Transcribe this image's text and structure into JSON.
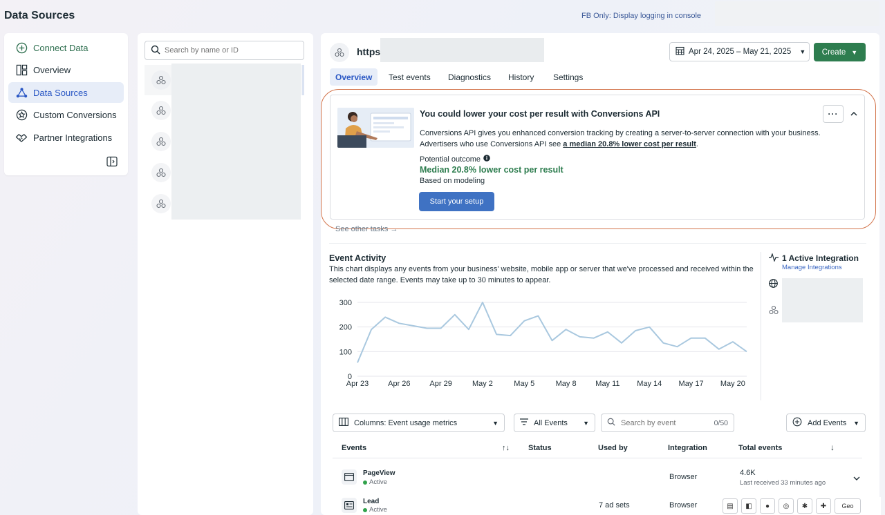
{
  "page_title": "Data Sources",
  "fb_only_link": "FB Only: Display logging in console",
  "leftnav": {
    "items": [
      {
        "label": "Connect Data",
        "icon": "plus-circle-icon"
      },
      {
        "label": "Overview",
        "icon": "layout-icon"
      },
      {
        "label": "Data Sources",
        "icon": "data-sources-icon"
      },
      {
        "label": "Custom Conversions",
        "icon": "star-badge-icon"
      },
      {
        "label": "Partner Integrations",
        "icon": "handshake-icon"
      }
    ]
  },
  "source_search": {
    "placeholder": "Search by name or ID"
  },
  "pixel": {
    "name": "https"
  },
  "date_range": "Apr 24, 2025 – May 21, 2025",
  "create_label": "Create",
  "tabs": [
    "Overview",
    "Test events",
    "Diagnostics",
    "History",
    "Settings"
  ],
  "promo": {
    "title": "You could lower your cost per result with Conversions API",
    "body_1": "Conversions API gives you enhanced conversion tracking by creating a server-to-server connection with your business. Advertisers who use Conversions API see",
    "body_bold": "a median 20.8% lower cost per result",
    "body_end": ".",
    "potential_label": "Potential outcome",
    "potential_value": "Median 20.8% lower cost per result",
    "based_on": "Based on modeling",
    "cta": "Start your setup",
    "more": "···"
  },
  "see_other_tasks": "See other tasks →",
  "event_activity": {
    "title": "Event Activity",
    "description": "This chart displays any events from your business' website, mobile app or server that we've processed and received within the selected date range. Events may take up to 30 minutes to appear."
  },
  "chart_data": {
    "type": "line",
    "x_ticks": [
      "Apr 23",
      "Apr 26",
      "Apr 29",
      "May 2",
      "May 5",
      "May 8",
      "May 11",
      "May 14",
      "May 17",
      "May 20"
    ],
    "y_ticks": [
      0,
      100,
      200,
      300
    ],
    "ylim": [
      0,
      300
    ],
    "x": [
      "Apr 23",
      "Apr 24",
      "Apr 25",
      "Apr 26",
      "Apr 27",
      "Apr 28",
      "Apr 29",
      "Apr 30",
      "May 1",
      "May 2",
      "May 3",
      "May 4",
      "May 5",
      "May 6",
      "May 7",
      "May 8",
      "May 9",
      "May 10",
      "May 11",
      "May 12",
      "May 13",
      "May 14",
      "May 15",
      "May 16",
      "May 17",
      "May 18",
      "May 19",
      "May 20",
      "May 21"
    ],
    "series": [
      {
        "color": "#a9c8df",
        "values": [
          55,
          190,
          240,
          215,
          205,
          195,
          195,
          250,
          190,
          300,
          170,
          165,
          225,
          245,
          145,
          190,
          160,
          155,
          180,
          135,
          185,
          200,
          135,
          120,
          155,
          155,
          110,
          140,
          100
        ]
      }
    ],
    "grid": true
  },
  "integrations": {
    "title": "1 Active Integration",
    "manage": "Manage Integrations"
  },
  "controls": {
    "columns": "Columns: Event usage metrics",
    "filter": "All Events",
    "search_placeholder": "Search by event",
    "search_count": "0/50",
    "add_events": "Add Events"
  },
  "table": {
    "headers": {
      "events": "Events",
      "status": "Status",
      "used_by": "Used by",
      "integration": "Integration",
      "total": "Total events"
    },
    "rows": [
      {
        "name": "PageView",
        "status": "Active",
        "used_by": "",
        "integration": "Browser",
        "total": "4.6K",
        "last_received": "Last received 33 minutes ago"
      },
      {
        "name": "Lead",
        "status": "Active",
        "used_by": "7 ad sets",
        "integration": "Browser",
        "total": "",
        "last_received": ""
      }
    ]
  },
  "extensions": {
    "geo": "Geo"
  }
}
